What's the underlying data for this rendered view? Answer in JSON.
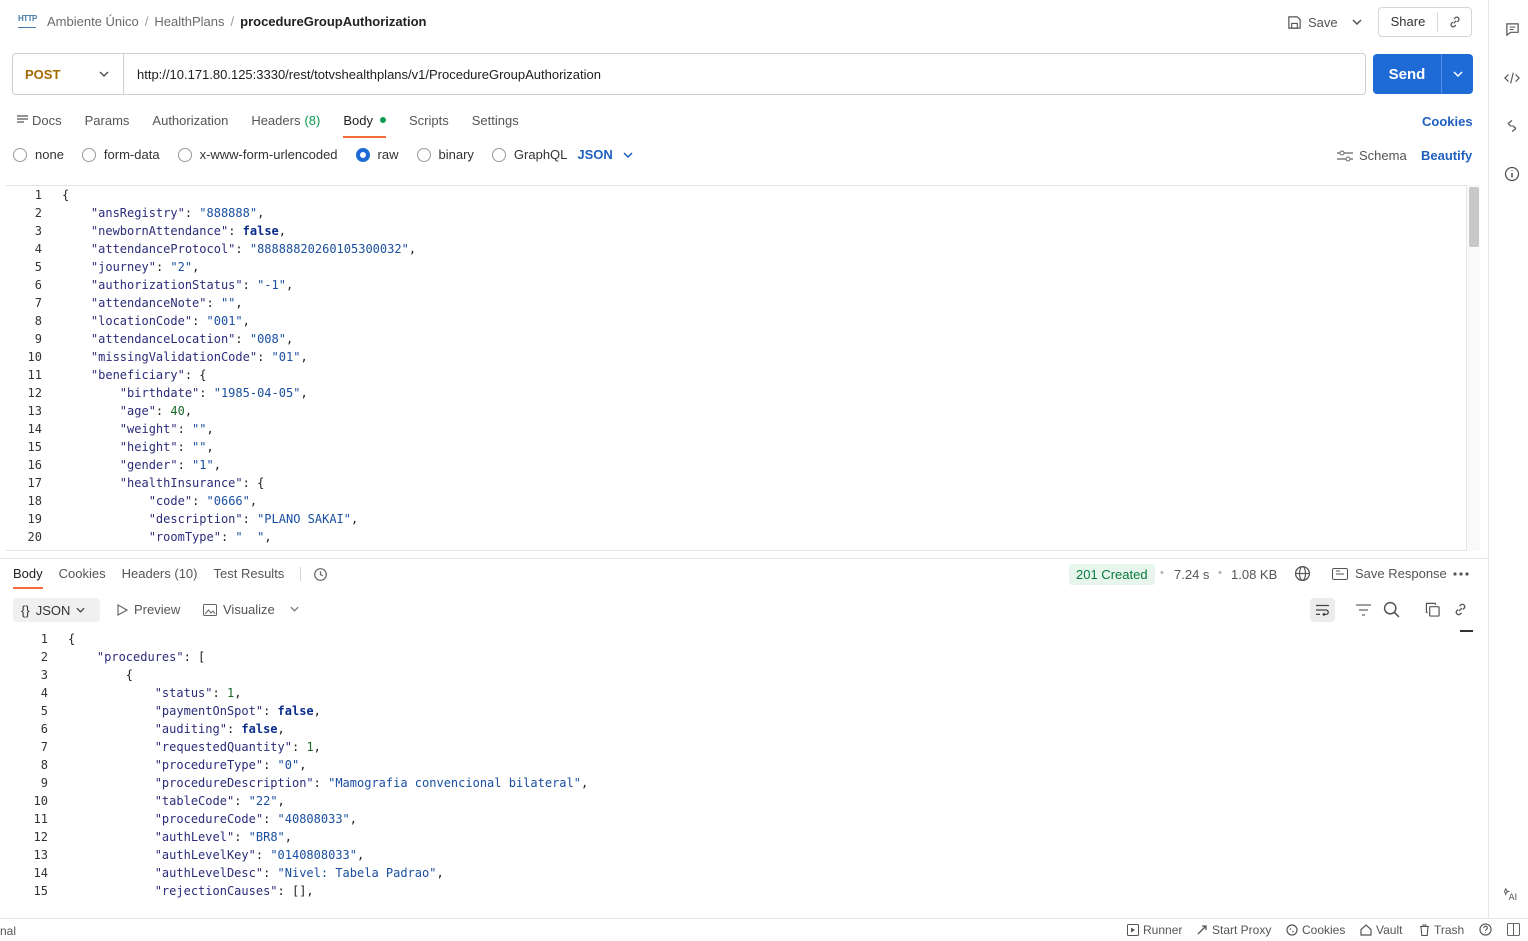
{
  "breadcrumb": {
    "icon_text": "HTTP",
    "items": [
      "Ambiente Único",
      "HealthPlans"
    ],
    "current": "procedureGroupAuthorization"
  },
  "header": {
    "save_label": "Save",
    "share_label": "Share"
  },
  "request": {
    "method": "POST",
    "url": "http://10.171.80.125:3330/rest/totvshealthplans/v1/ProcedureGroupAuthorization",
    "send_label": "Send",
    "tabs": [
      {
        "label": "Docs"
      },
      {
        "label": "Params"
      },
      {
        "label": "Authorization"
      },
      {
        "label": "Headers",
        "count": "(8)"
      },
      {
        "label": "Body"
      },
      {
        "label": "Scripts"
      },
      {
        "label": "Settings"
      }
    ],
    "cookies_label": "Cookies",
    "body_types": [
      "none",
      "form-data",
      "x-www-form-urlencoded",
      "raw",
      "binary",
      "GraphQL"
    ],
    "selected_body_type": "raw",
    "format": "JSON",
    "schema_label": "Schema",
    "beautify_label": "Beautify"
  },
  "request_body_lines": [
    "{",
    "    \"ansRegistry\": \"888888\",",
    "    \"newbornAttendance\": false,",
    "    \"attendanceProtocol\": \"88888820260105300032\",",
    "    \"journey\": \"2\",",
    "    \"authorizationStatus\": \"-1\",",
    "    \"attendanceNote\": \"\",",
    "    \"locationCode\": \"001\",",
    "    \"attendanceLocation\": \"008\",",
    "    \"missingValidationCode\": \"01\",",
    "    \"beneficiary\": {",
    "        \"birthdate\": \"1985-04-05\",",
    "        \"age\": 40,",
    "        \"weight\": \"\",",
    "        \"height\": \"\",",
    "        \"gender\": \"1\",",
    "        \"healthInsurance\": {",
    "            \"code\": \"0666\",",
    "            \"description\": \"PLANO SAKAI\",",
    "            \"roomType\": \"  \","
  ],
  "response": {
    "tabs": [
      {
        "label": "Body"
      },
      {
        "label": "Cookies"
      },
      {
        "label": "Headers",
        "count": "(10)"
      },
      {
        "label": "Test Results"
      }
    ],
    "status": "201 Created",
    "time": "7.24 s",
    "size": "1.08 KB",
    "save_response_label": "Save Response",
    "format": "JSON",
    "format_prefix": "{}",
    "preview_label": "Preview",
    "visualize_label": "Visualize"
  },
  "response_body_lines": [
    "{",
    "    \"procedures\": [",
    "        {",
    "            \"status\": 1,",
    "            \"paymentOnSpot\": false,",
    "            \"auditing\": false,",
    "            \"requestedQuantity\": 1,",
    "            \"procedureType\": \"0\",",
    "            \"procedureDescription\": \"Mamografia convencional bilateral\",",
    "            \"tableCode\": \"22\",",
    "            \"procedureCode\": \"40808033\",",
    "            \"authLevel\": \"BR8\",",
    "            \"authLevelKey\": \"0140808033\",",
    "            \"authLevelDesc\": \"Nivel: Tabela Padrao\",",
    "            \"rejectionCauses\": [],"
  ],
  "footer": {
    "left_label": "nal",
    "items": [
      "Runner",
      "Start Proxy",
      "Cookies",
      "Vault",
      "Trash"
    ]
  },
  "icons": {
    "rail": [
      "comment-icon",
      "code-icon",
      "history-swap-icon",
      "info-icon",
      "ai-icon"
    ]
  },
  "colors": {
    "send_button": "#1f6bd6",
    "method_text": "#a36a00",
    "active_tab_underline": "#f26b3a",
    "status_ok_bg": "#e7f5ec",
    "status_ok_text": "#0b7a3e"
  }
}
